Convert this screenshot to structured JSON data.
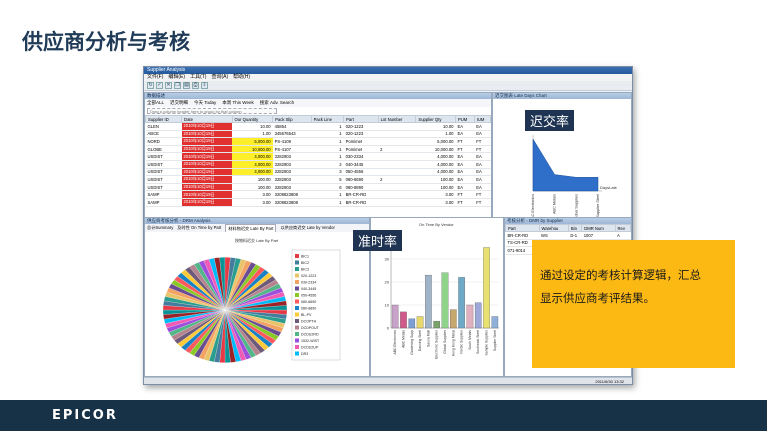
{
  "slide": {
    "title": "供应商分析与考核",
    "late_label": "迟交率",
    "ontime_label": "准时率",
    "callout_line1": "通过设定的考核计算逻辑，汇总",
    "callout_line2": "显示供应商考评结果。",
    "footer_logo": "EPICOR",
    "colors": {
      "title": "#1f3b57",
      "footer": "#173246",
      "callout": "#fdb913",
      "label_bg": "#1e3452"
    }
  },
  "app": {
    "window_title": "Supplier Analysis",
    "menu": [
      "文件(F)",
      "编辑(E)",
      "工具(T)",
      "查询(A)",
      "帮助(H)"
    ],
    "grid_header": "数据描述",
    "filter_tabs": [
      "全部ALL",
      "迟交明细",
      "今天 Today",
      "本周 This Week",
      "搜索 Adv. Search"
    ],
    "group_hint": "Drag a column header here to group by that column",
    "columns": [
      "Supplier ID",
      "Date",
      "Our Quantity",
      "Pack Slip",
      "Pack Line",
      "Part",
      "Lot Number",
      "Supplier Qty",
      "PUM",
      "IUM"
    ],
    "rows": [
      [
        "GLEN",
        "2010年10月19日",
        "10.00",
        "45854",
        "1",
        "020-1223",
        "",
        "10.00",
        "EA",
        "EA"
      ],
      [
        "ABCE",
        "2010年10月19日",
        "1.00",
        "345676543",
        "1",
        "020-1223",
        "",
        "1.00",
        "EA",
        "EA"
      ],
      [
        "NORD",
        "2010年10月19日",
        "5,000.00",
        "PS-4109",
        "1",
        "Pomimet",
        "",
        "5,000.00",
        "FT",
        "FT"
      ],
      [
        "GLOBE",
        "2010年10月19日",
        "10,000.00",
        "PS-4107",
        "1",
        "Pomimet",
        "2",
        "10,000.00",
        "FT",
        "FT"
      ],
      [
        "USDIST",
        "2010年10月19日",
        "4,000.00",
        "3282903",
        "1",
        "030-2334",
        "",
        "4,000.00",
        "EA",
        "EA"
      ],
      [
        "USDIST",
        "2010年10月19日",
        "4,000.00",
        "3282903",
        "2",
        "040-3445",
        "",
        "4,000.00",
        "EA",
        "EA"
      ],
      [
        "USDIST",
        "2010年10月19日",
        "4,000.00",
        "3282903",
        "3",
        "050-4556",
        "",
        "4,000.00",
        "EA",
        "EA"
      ],
      [
        "USDIST",
        "2010年10月19日",
        "100.00",
        "3282903",
        "5",
        "080-6690",
        "2",
        "100.00",
        "EA",
        "EA"
      ],
      [
        "USDIST",
        "2010年10月19日",
        "100.00",
        "3282903",
        "6",
        "080-8890",
        "",
        "100.00",
        "EA",
        "EA"
      ],
      [
        "SAMP",
        "2010年10月19日",
        "3.00",
        "3208823808",
        "1",
        "BR-CR-RD",
        "",
        "3.00",
        "FT",
        "FT"
      ],
      [
        "SAMP",
        "2010年10月19日",
        "3.00",
        "3208823808",
        "1",
        "BR-CR-RD",
        "",
        "3.00",
        "FT",
        "FT"
      ]
    ],
    "late_header": "迟交图表 Late Days Chart",
    "late_chart": {
      "type": "area",
      "categories": [
        "ABC Electronics",
        "ABC Metals",
        "Global Supplies",
        "Supplier Steel"
      ],
      "values": [
        19,
        6,
        5,
        5
      ],
      "legend": "DaysLate"
    },
    "bottom_header": "供应商考核分析 - DRM Analysis",
    "bottom_tabs": [
      "总计Summary",
      "及时性 On Time by Part",
      "材料物迟交 Late By Part",
      "以供应商迟交 Late by Vendor"
    ],
    "pie_title": "按物料迟交 Late By Part",
    "pie_legend": [
      "BIC1",
      "BIC2",
      "BIC3",
      "020-1223",
      "030-2334",
      "040-3445",
      "050-4556",
      "080-6690",
      "080-8890",
      "BL-PV",
      "DCOPTH",
      "DCDPOUT",
      "DCDU2RD",
      "1532-WIST",
      "DCDU2UP",
      "DR3"
    ],
    "bar_header": "On Time By Vendor",
    "bar_chart": {
      "type": "bar",
      "categories": [
        "ABC Electronics",
        "ABC Metals",
        "Gardening Supp",
        "Dancing Steel",
        "Sauna Mall",
        "Electronic Supplies",
        "Global Supplies",
        "Hong Kong Metal",
        "Nordic Supplies",
        "South Metals",
        "Southeast Steel",
        "Sample Supplies",
        "Supplier Steel"
      ],
      "values": [
        10,
        7,
        4,
        5,
        23,
        3,
        24,
        8,
        22,
        10,
        11,
        35,
        5
      ],
      "ylim": [
        0,
        40
      ],
      "yticks": [
        "0",
        "10",
        "20",
        "30"
      ]
    },
    "cmr_header": "考核分析 - DMR by Supplier",
    "cmr_columns": [
      "Part",
      "Warehou",
      "Bin",
      "DMR Num",
      "Rev"
    ],
    "cmr_rows": [
      [
        "BR-CR-RD",
        "WS",
        "D-1",
        "1007",
        "A"
      ],
      [
        "TS-CR-RD",
        "",
        "",
        "",
        ""
      ],
      [
        "071-9014",
        "",
        "",
        "",
        ""
      ]
    ],
    "status_date": "2011/6/30",
    "status_time": "13:32"
  }
}
